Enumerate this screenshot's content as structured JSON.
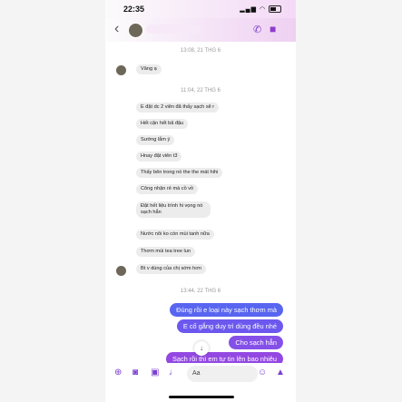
{
  "status": {
    "time": "22:35"
  },
  "header": {
    "back_icon": "chevron-left-icon",
    "call_icon": "phone-icon",
    "video_icon": "video-camera-icon"
  },
  "timestamps": [
    "13:08, 21 THG 6",
    "11:04, 22 THG 6",
    "13:44, 22 THG 6"
  ],
  "incoming": [
    "Vâng ạ",
    "E đặt dc 2 viên đã thấy sạch sẽ r",
    "Hết cặn hết bã đậu",
    "Sướng lắm ý",
    "Hnay đặt viên t3",
    "Thấy bên trong nó the the mát hihi",
    "Công nhận rẻ mà cồ vồ",
    "Đặt hết liệu trình hi vọng nó sạch hẳn",
    "Nước nôi ko còn mùi tanh nữa",
    "Thơm mùi tea tree lun",
    "Bt v dùng của chị sớm hơn"
  ],
  "outgoing": [
    "Đúng rồi e loại này sạch thơm mà",
    "E cố gắng duy trì dùng đều nhé",
    "Cho sạch hẳn",
    "Sạch rồi thì em tự tin lên bao nhiêu"
  ],
  "composer": {
    "placeholder": "Aa"
  }
}
